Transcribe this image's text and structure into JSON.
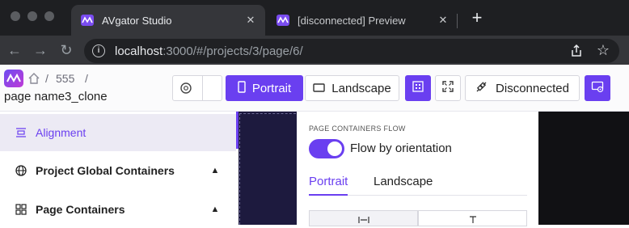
{
  "browser": {
    "tabs": [
      {
        "title": "AVgator Studio",
        "active": true
      },
      {
        "title": "[disconnected] Preview",
        "active": false
      }
    ],
    "url": {
      "host": "localhost",
      "rest": ":3000/#/projects/3/page/6/"
    }
  },
  "header": {
    "breadcrumb": [
      "555"
    ],
    "page_name": "page name3_clone",
    "buttons": {
      "portrait": "Portrait",
      "landscape": "Landscape",
      "disconnected": "Disconnected"
    }
  },
  "sidebar": {
    "items": [
      {
        "label": "Alignment",
        "icon": "alignment-icon",
        "active": true
      },
      {
        "label": "Project Global Containers",
        "icon": "globe-icon",
        "active": false
      },
      {
        "label": "Page Containers",
        "icon": "grid-icon",
        "active": false
      }
    ]
  },
  "panel": {
    "section_label": "PAGE CONTAINERS FLOW",
    "toggle_label": "Flow by orientation",
    "toggle_on": true,
    "tabs": [
      "Portrait",
      "Landscape"
    ],
    "active_tab": "Portrait"
  },
  "colors": {
    "accent": "#6a3ff0",
    "browser_bg": "#1e1f22",
    "canvas": "#1d1a3e"
  }
}
